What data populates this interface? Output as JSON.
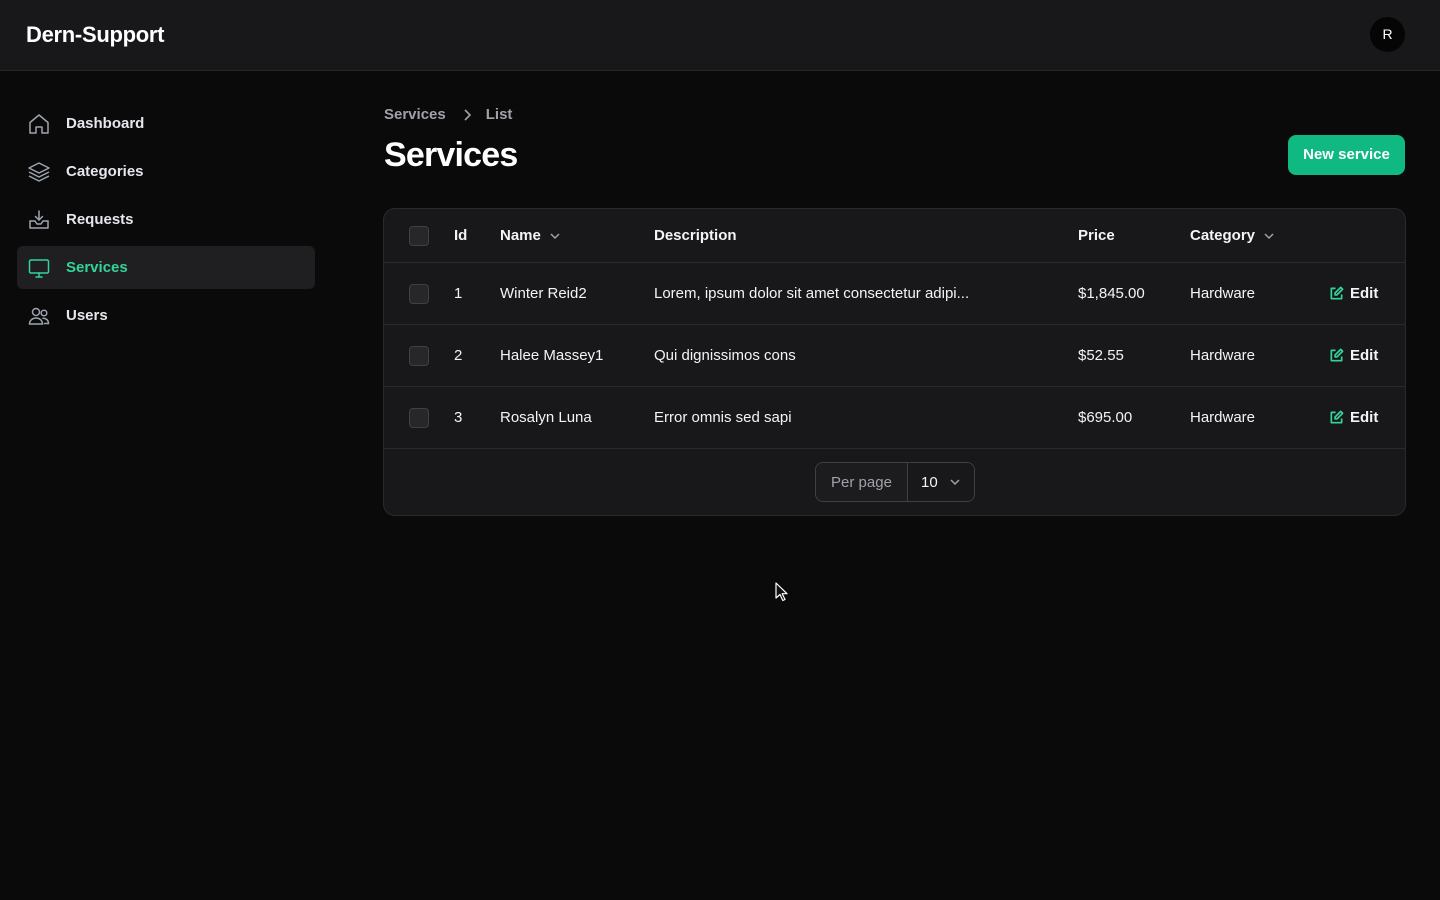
{
  "app": {
    "brand": "Dern-Support",
    "avatar_initial": "R"
  },
  "sidebar": {
    "items": [
      {
        "label": "Dashboard",
        "icon": "home-icon",
        "active": false
      },
      {
        "label": "Categories",
        "icon": "layers-icon",
        "active": false
      },
      {
        "label": "Requests",
        "icon": "inbox-icon",
        "active": false
      },
      {
        "label": "Services",
        "icon": "monitor-icon",
        "active": true
      },
      {
        "label": "Users",
        "icon": "users-icon",
        "active": false
      }
    ]
  },
  "breadcrumb": {
    "parent": "Services",
    "current": "List"
  },
  "page": {
    "title": "Services",
    "new_button": "New service"
  },
  "table": {
    "columns": {
      "id": "Id",
      "name": "Name",
      "description": "Description",
      "price": "Price",
      "category": "Category"
    },
    "rows": [
      {
        "id": "1",
        "name": "Winter Reid2",
        "description": "Lorem, ipsum dolor sit amet consectetur adipi...",
        "price": "$1,845.00",
        "category": "Hardware",
        "action": "Edit"
      },
      {
        "id": "2",
        "name": "Halee Massey1",
        "description": "Qui dignissimos cons",
        "price": "$52.55",
        "category": "Hardware",
        "action": "Edit"
      },
      {
        "id": "3",
        "name": "Rosalyn Luna",
        "description": "Error omnis sed sapi",
        "price": "$695.00",
        "category": "Hardware",
        "action": "Edit"
      }
    ],
    "pagination": {
      "per_page_label": "Per page",
      "per_page_value": "10"
    }
  },
  "colors": {
    "accent": "#10b981",
    "accent_text": "#34d399",
    "background": "#0a0a0b",
    "surface": "#18181a"
  }
}
